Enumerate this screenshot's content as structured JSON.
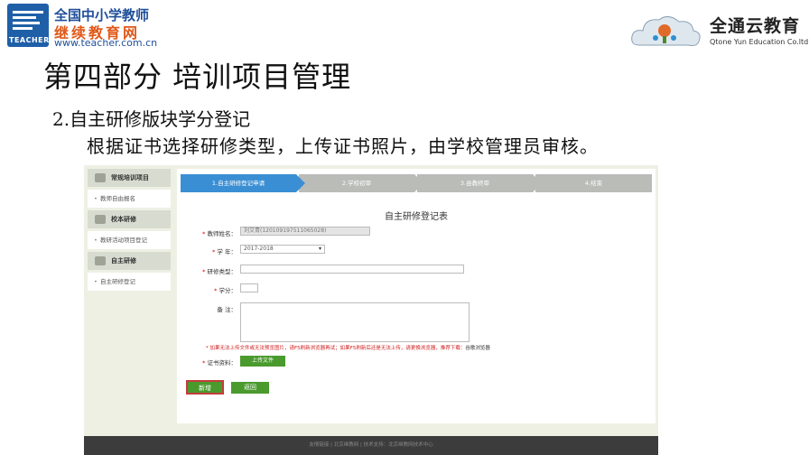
{
  "header": {
    "left_logo": {
      "badge_text": "TEACHER",
      "line1": "全国中小学教师",
      "line2": "继续教育网",
      "url": "www.teacher.com.cn"
    },
    "right_logo": {
      "brand": "全通云教育",
      "brand_sub": "Qtone Yun Education Co.ltd"
    }
  },
  "slide": {
    "title": "第四部分  培训项目管理",
    "subtitle": "2.自主研修版块学分登记",
    "description": "根据证书选择研修类型，上传证书照片，由学校管理员审核。"
  },
  "screenshot": {
    "sidebar": [
      {
        "type": "head",
        "label": "常规培训项目",
        "icon": "folder-icon"
      },
      {
        "type": "item",
        "label": "教师自由报名"
      },
      {
        "type": "head",
        "label": "校本研修",
        "icon": "folder-icon"
      },
      {
        "type": "item",
        "label": "教研活动项目登记"
      },
      {
        "type": "head",
        "label": "自主研修",
        "icon": "folder-icon"
      },
      {
        "type": "item",
        "label": "自主研修登记"
      }
    ],
    "steps": [
      "1.自主研修登记申请",
      "2.学校初审",
      "3.县教终审",
      "4.结束"
    ],
    "form": {
      "title": "自主研修登记表",
      "teacher_label": "教师姓名：",
      "teacher_value": "刘艾青(120109197511065028)",
      "year_label": "学  年：",
      "year_value": "2017-2018",
      "type_label": "研修类型：",
      "type_value": "",
      "credit_label": "学分：",
      "credit_value": "",
      "remark_label": "备  注：",
      "remark_value": "",
      "notice": "加果无法上传文件或无法预览图片，请F5刷新浏览器再试；如果F5刷新后还是无法上传，请更换浏览器，推荐下载：",
      "notice_link": "谷歌浏览器",
      "cert_label": "证书资料：",
      "upload_label": "上传文件",
      "save_label": "新增",
      "back_label": "返回"
    },
    "footer": "友情链接  |  北京继教网  |  技术支持：北京继教网技术中心"
  },
  "colors": {
    "active_step": "#3a8fd4",
    "button_green": "#4a9a2e",
    "required_red": "#d00000"
  }
}
